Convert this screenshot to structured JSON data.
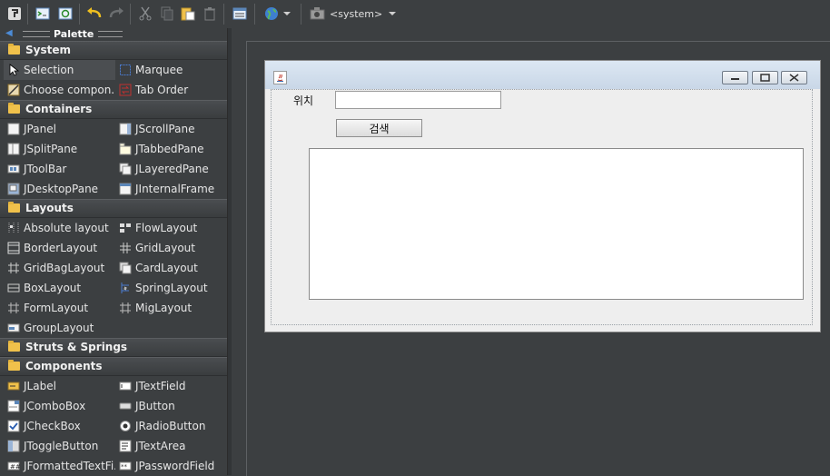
{
  "toolbar": {
    "laf_label": "<system>"
  },
  "palette": {
    "title": "Palette",
    "categories": [
      {
        "name": "System",
        "items": [
          {
            "label": "Selection",
            "icon": "pointer-icon"
          },
          {
            "label": "Marquee",
            "icon": "marquee-icon"
          },
          {
            "label": "Choose compon...",
            "icon": "choose-component-icon"
          },
          {
            "label": "Tab Order",
            "icon": "tab-order-icon"
          }
        ]
      },
      {
        "name": "Containers",
        "items": [
          {
            "label": "JPanel",
            "icon": "jpanel-icon"
          },
          {
            "label": "JScrollPane",
            "icon": "jscrollpane-icon"
          },
          {
            "label": "JSplitPane",
            "icon": "jsplitpane-icon"
          },
          {
            "label": "JTabbedPane",
            "icon": "jtabbedpane-icon"
          },
          {
            "label": "JToolBar",
            "icon": "jtoolbar-icon"
          },
          {
            "label": "JLayeredPane",
            "icon": "jlayeredpane-icon"
          },
          {
            "label": "JDesktopPane",
            "icon": "jdesktoppane-icon"
          },
          {
            "label": "JInternalFrame",
            "icon": "jinternalframe-icon"
          }
        ]
      },
      {
        "name": "Layouts",
        "items": [
          {
            "label": "Absolute layout",
            "icon": "absolute-layout-icon"
          },
          {
            "label": "FlowLayout",
            "icon": "flowlayout-icon"
          },
          {
            "label": "BorderLayout",
            "icon": "borderlayout-icon"
          },
          {
            "label": "GridLayout",
            "icon": "gridlayout-icon"
          },
          {
            "label": "GridBagLayout",
            "icon": "gridbaglayout-icon"
          },
          {
            "label": "CardLayout",
            "icon": "cardlayout-icon"
          },
          {
            "label": "BoxLayout",
            "icon": "boxlayout-icon"
          },
          {
            "label": "SpringLayout",
            "icon": "springlayout-icon"
          },
          {
            "label": "FormLayout",
            "icon": "formlayout-icon"
          },
          {
            "label": "MigLayout",
            "icon": "miglayout-icon"
          },
          {
            "label": "GroupLayout",
            "icon": "grouplayout-icon"
          }
        ]
      },
      {
        "name": "Struts & Springs",
        "items": []
      },
      {
        "name": "Components",
        "items": [
          {
            "label": "JLabel",
            "icon": "jlabel-icon"
          },
          {
            "label": "JTextField",
            "icon": "jtextfield-icon"
          },
          {
            "label": "JComboBox",
            "icon": "jcombobox-icon"
          },
          {
            "label": "JButton",
            "icon": "jbutton-icon"
          },
          {
            "label": "JCheckBox",
            "icon": "jcheckbox-icon"
          },
          {
            "label": "JRadioButton",
            "icon": "jradiobutton-icon"
          },
          {
            "label": "JToggleButton",
            "icon": "jtogglebutton-icon"
          },
          {
            "label": "JTextArea",
            "icon": "jtextarea-icon"
          },
          {
            "label": "JFormattedTextFi...",
            "icon": "jformattedtextfield-icon"
          },
          {
            "label": "JPasswordField",
            "icon": "jpasswordfield-icon"
          }
        ]
      }
    ]
  },
  "form": {
    "location_label": "위치",
    "location_value": "",
    "search_button": "검색",
    "result_text": ""
  }
}
